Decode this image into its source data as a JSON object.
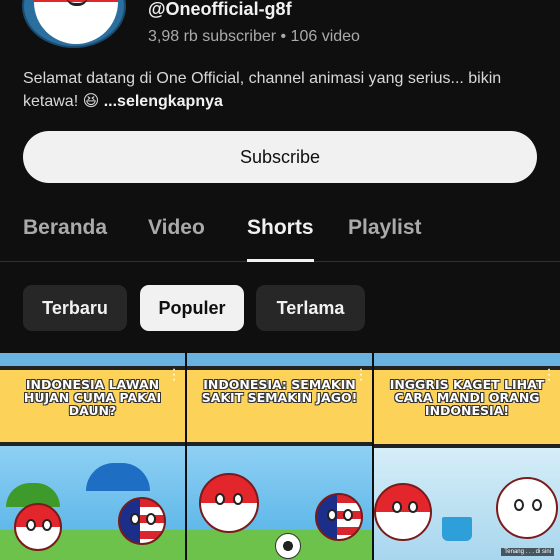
{
  "channel": {
    "handle": "@Oneofficial-g8f",
    "stats": "3,98 rb subscriber • 106 video",
    "description": "Selamat datang di One Official, channel animasi yang serius... bikin ketawa! 😆",
    "more": "...selengkapnya"
  },
  "subscribe_label": "Subscribe",
  "tabs": [
    {
      "label": "Beranda",
      "active": false
    },
    {
      "label": "Video",
      "active": false
    },
    {
      "label": "Shorts",
      "active": true
    },
    {
      "label": "Playlist",
      "active": false
    }
  ],
  "chips": [
    {
      "label": "Terbaru",
      "selected": false
    },
    {
      "label": "Populer",
      "selected": true
    },
    {
      "label": "Terlama",
      "selected": false
    }
  ],
  "shorts": [
    {
      "title": "Indonesia lawan hujan cuma pakai daun?"
    },
    {
      "title": "Indonesia: semakin sakit semakin jago!"
    },
    {
      "title": "Inggris kaget lihat cara mandi orang Indonesia!",
      "caption": "Tenang . . . di sini"
    }
  ],
  "colors": {
    "background": "#0f0f0f",
    "banner": "#fcd259",
    "chip_selected": "#f1f1f1",
    "chip": "#272727"
  }
}
